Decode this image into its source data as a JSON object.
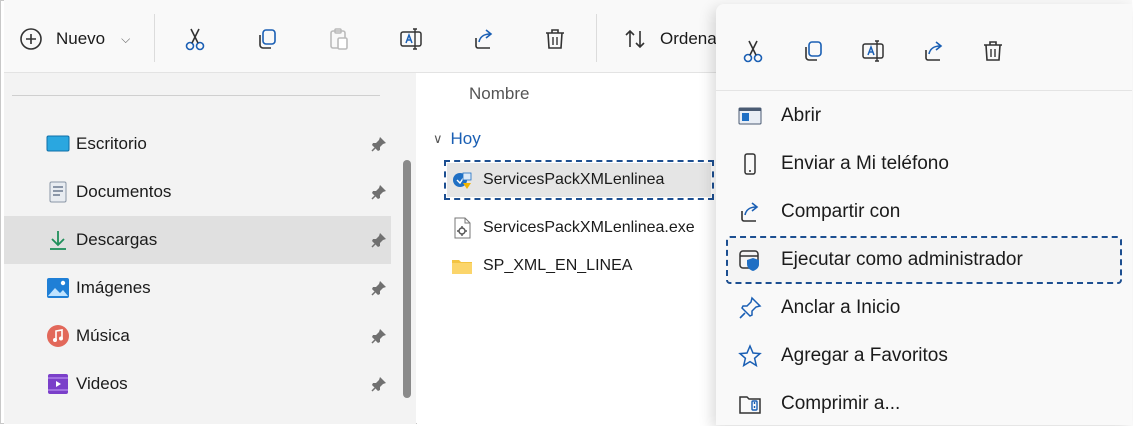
{
  "toolbar": {
    "new_label": "Nuevo",
    "sort_label": "Ordena",
    "icons": [
      "add-icon",
      "cut-icon",
      "copy-icon",
      "paste-icon",
      "rename-icon",
      "share-icon",
      "delete-icon",
      "sort-icon"
    ]
  },
  "sidebar": {
    "items": [
      {
        "label": "Escritorio",
        "icon": "desktop-icon"
      },
      {
        "label": "Documentos",
        "icon": "documents-icon"
      },
      {
        "label": "Descargas",
        "icon": "downloads-icon",
        "selected": true
      },
      {
        "label": "Imágenes",
        "icon": "pictures-icon"
      },
      {
        "label": "Música",
        "icon": "music-icon"
      },
      {
        "label": "Videos",
        "icon": "videos-icon"
      }
    ]
  },
  "content": {
    "column_header": "Nombre",
    "group_label": "Hoy",
    "files": [
      {
        "name": "ServicesPackXMLenlinea",
        "icon": "installer-shortcut-icon",
        "selected": true
      },
      {
        "name": "ServicesPackXMLenlinea.exe",
        "icon": "exe-file-icon"
      },
      {
        "name": "SP_XML_EN_LINEA",
        "icon": "folder-icon"
      }
    ]
  },
  "context_menu": {
    "items": [
      {
        "label": "Abrir",
        "icon": "open-icon"
      },
      {
        "label": "Enviar a Mi teléfono",
        "icon": "phone-icon"
      },
      {
        "label": "Compartir con",
        "icon": "share-icon"
      },
      {
        "label": "Ejecutar como administrador",
        "icon": "shield-admin-icon",
        "highlighted": true
      },
      {
        "label": "Anclar a Inicio",
        "icon": "pin-icon"
      },
      {
        "label": "Agregar a Favoritos",
        "icon": "star-icon"
      },
      {
        "label": "Comprimir a...",
        "icon": "zip-icon"
      }
    ]
  },
  "colors": {
    "accent": "#1a5fb4",
    "highlight_outline": "#1d4f91",
    "selection_bg": "#e0e0e0"
  }
}
